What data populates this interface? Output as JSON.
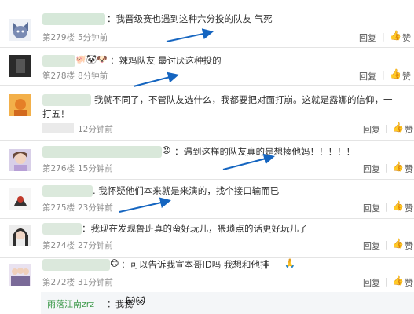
{
  "comments": [
    {
      "text": "：我晋级赛也遇到这种六分投的队友 气死",
      "floor": "第279楼",
      "time": "5分钟前",
      "reply": "回复",
      "like": "赞"
    },
    {
      "text": "：辣鸡队友 最讨厌这种投的",
      "floor": "第278楼",
      "time": "8分钟前",
      "reply": "回复",
      "like": "赞"
    },
    {
      "text": "我就不同了，不管队友选什么，我都要把对面打崩。这就是露娜的信仰，一",
      "text2": "打五！",
      "floor": "",
      "time": "12分钟前",
      "reply": "回复",
      "like": "赞"
    },
    {
      "text": "：遇到这样的队友真的是想揍他妈！！！！！",
      "floor": "第276楼",
      "time": "15分钟前",
      "reply": "回复",
      "like": "赞"
    },
    {
      "text": ". 我怀疑他们本来就是来演的，找个接口输而已",
      "floor": "第275楼",
      "time": "23分钟前",
      "reply": "回复",
      "like": "赞"
    },
    {
      "text": "：我现在发现鲁班真的蛮好玩儿，猥琐点的话更好玩儿了",
      "floor": "第274楼",
      "time": "27分钟前",
      "reply": "回复",
      "like": "赞"
    },
    {
      "text": "：可以告诉我宣本哥ID吗 我想和他排",
      "floor": "第272楼",
      "time": "31分钟前",
      "reply": "回复",
      "like": "赞"
    }
  ],
  "sub_reply": {
    "user": "雨落江南zrz",
    "text": "：我我"
  },
  "colors": {
    "user_blur": "#cfe3d3",
    "link_green": "#3e9a4c",
    "arrow_blue": "#1565c0"
  }
}
